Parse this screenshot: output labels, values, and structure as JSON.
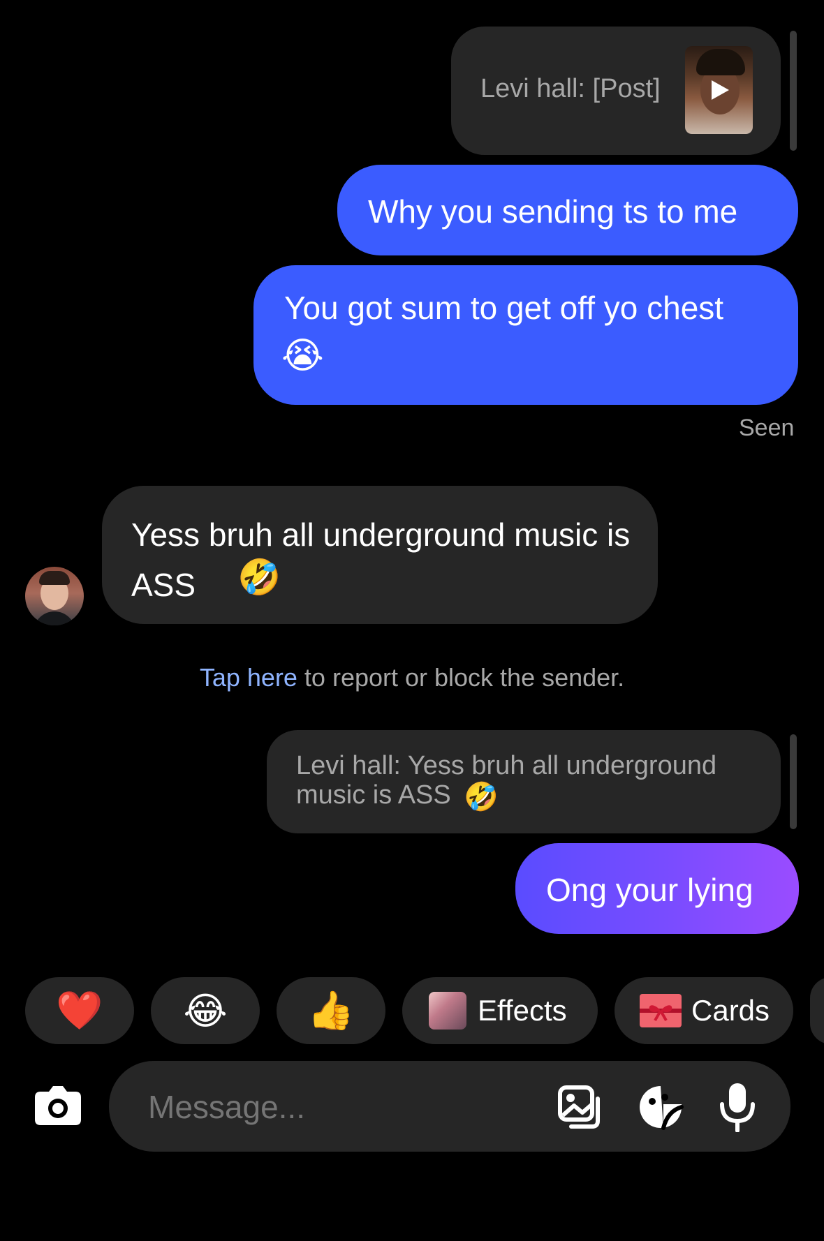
{
  "thread": {
    "reply1": {
      "text": "Levi hall: [Post]"
    },
    "msg1": {
      "text": "Why you sending ts to me"
    },
    "msg2": {
      "text": "You got sum to get off yo chest",
      "emoji": "😭"
    },
    "seen": "Seen",
    "incoming": {
      "text": "Yess bruh all underground music is ASS",
      "emoji": "🤣"
    },
    "report": {
      "link": "Tap here",
      "rest": " to report or block the sender."
    },
    "reply2": {
      "text": "Levi hall: Yess bruh all underground music is ASS",
      "emoji": "🤣"
    },
    "msg3": {
      "text": "Ong your lying"
    }
  },
  "quick_reactions": {
    "heart": "❤️",
    "laugh": "😂",
    "thumbs": "👍",
    "effects_label": "Effects",
    "cards_label": "Cards"
  },
  "composer": {
    "placeholder": "Message..."
  },
  "colors": {
    "sent_blue": "#3b5cff",
    "sent_gradient_end": "#9a4cff",
    "incoming_bg": "#262626",
    "link": "#8fb4ff"
  }
}
